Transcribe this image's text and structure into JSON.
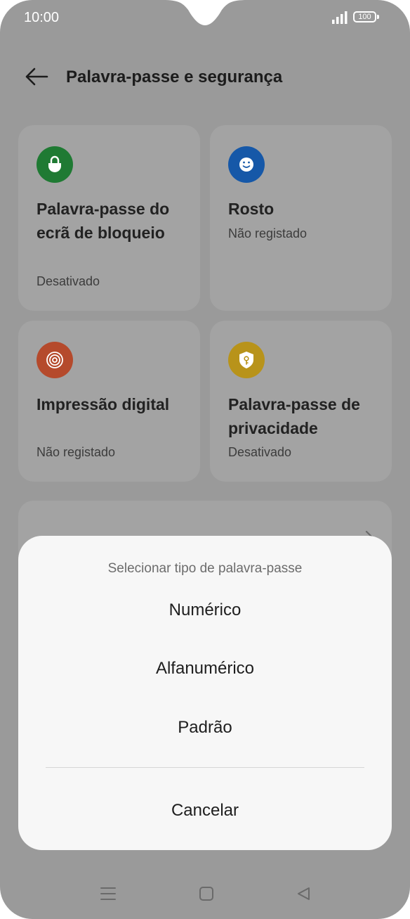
{
  "status_bar": {
    "time": "10:00",
    "battery": "100"
  },
  "header": {
    "title": "Palavra-passe e segurança"
  },
  "cards": [
    {
      "title": "Palavra-passe do ecrã de bloqueio",
      "status": "Desativado",
      "icon": "lock-icon",
      "color": "#1f7a33"
    },
    {
      "title": "Rosto",
      "status": "Não registado",
      "icon": "face-icon",
      "color": "#1658a8"
    },
    {
      "title": "Impressão digital",
      "status": "Não registado",
      "icon": "fingerprint-icon",
      "color": "#b54a2c"
    },
    {
      "title": "Palavra-passe de privacidade",
      "status": "Desativado",
      "icon": "privacy-shield-icon",
      "color": "#b8931a"
    }
  ],
  "dialog": {
    "title": "Selecionar tipo de palavra-passe",
    "options": [
      "Numérico",
      "Alfanumérico",
      "Padrão"
    ],
    "cancel": "Cancelar"
  }
}
